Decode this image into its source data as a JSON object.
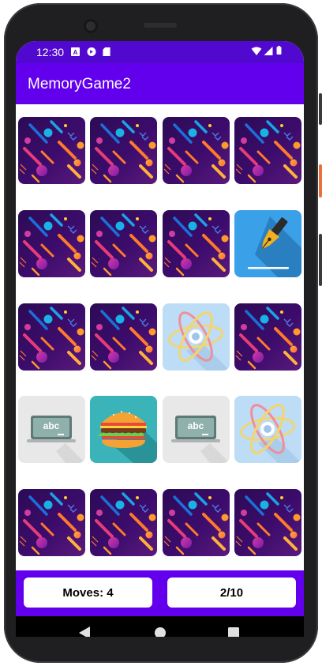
{
  "status_bar": {
    "time": "12:30",
    "icons": [
      "keyboard-a-icon",
      "media-icon",
      "sd-card-icon",
      "wifi-icon",
      "signal-icon",
      "battery-icon"
    ]
  },
  "app_bar": {
    "title": "MemoryGame2"
  },
  "colors": {
    "status_bar": "#5209cf",
    "app_bar": "#6200ee",
    "card_back": "#3a0a6a"
  },
  "board": {
    "rows": 5,
    "columns": 4,
    "cards": [
      "back",
      "back",
      "back",
      "back",
      "back",
      "back",
      "back",
      "fountain-pen-icon",
      "back",
      "back",
      "atom-icon",
      "back",
      "chalkboard-abc-icon",
      "burger-icon",
      "chalkboard-abc-icon",
      "atom-icon",
      "back",
      "back",
      "back",
      "back"
    ],
    "chalkboard_text": "abc"
  },
  "footer": {
    "moves": "Moves: 4",
    "pairs": "2/10"
  },
  "nav_bar": {
    "back": "back-icon",
    "home": "home-icon",
    "recents": "recents-icon"
  }
}
